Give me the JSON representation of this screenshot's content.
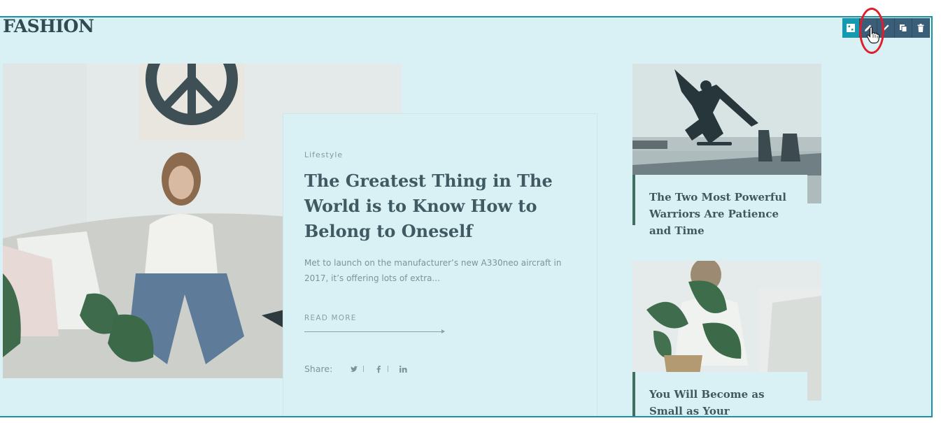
{
  "section": {
    "title": "FASHION"
  },
  "main_post": {
    "category": "Lifestyle",
    "title": "The Greatest Thing in The World is to Know How to Belong to Oneself",
    "excerpt": "Met to launch on the manufacturer’s new A330neo aircraft in 2017, it’s offering lots of extra...",
    "read_more_label": "READ MORE",
    "share_label": "Share:",
    "share_icons": [
      "twitter-icon",
      "facebook-icon",
      "linkedin-icon"
    ]
  },
  "side_posts": [
    {
      "title": "The Two Most Powerful Warriors Are Patience and Time"
    },
    {
      "title": "You Will Become as Small as Your Controlling Desire"
    }
  ],
  "toolbar": {
    "buttons": [
      "layout-icon",
      "edit-icon",
      "pencil-icon",
      "copy-icon",
      "trash-icon"
    ]
  },
  "colors": {
    "overlay": "#d9f1f5",
    "border": "#1e90a3",
    "toolbar": "#3b5e78",
    "toolbar_accent": "#1599b0",
    "annotation": "#e11d2a"
  }
}
